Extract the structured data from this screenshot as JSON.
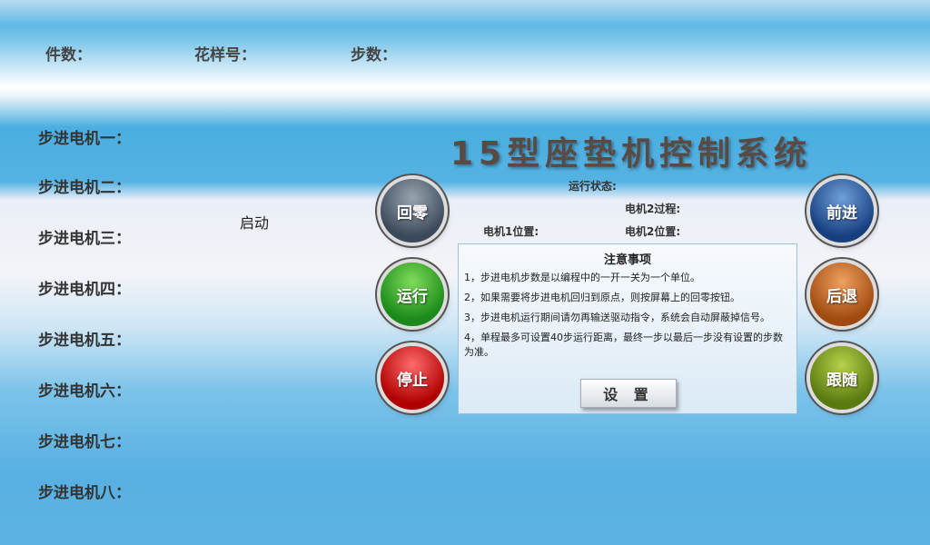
{
  "header": {
    "count_label": "件数：",
    "pattern_label": "花样号：",
    "steps_label": "步数："
  },
  "motors": [
    "步进电机一：",
    "步进电机二：",
    "步进电机三：",
    "步进电机四：",
    "步进电机五：",
    "步进电机六：",
    "步进电机七：",
    "步进电机八："
  ],
  "start_label": "启动",
  "title": "15型座垫机控制系统",
  "status": {
    "run_state": "运行状态:",
    "motor2_process": "电机2过程:",
    "motor1_position": "电机1位置:",
    "motor2_position": "电机2位置:"
  },
  "buttons": {
    "home": "回零",
    "run": "运行",
    "stop": "停止",
    "forward": "前进",
    "back": "后退",
    "follow": "跟随"
  },
  "notice": {
    "title": "注意事项",
    "items": [
      "1，步进电机步数是以编程中的一开一关为一个单位。",
      "2，如果需要将步进电机回归到原点，则按屏幕上的回零按钮。",
      "3，步进电机运行期间请勿再输送驱动指令，系统会自动屏蔽掉信号。",
      "4，单程最多可设置40步运行距离，最终一步以最后一步没有设置的步数为准。"
    ],
    "set_button": "设 置"
  },
  "colors": {
    "home": "#3b4a5a",
    "run": "#1a8a1a",
    "stop": "#b00000",
    "forward": "#173f80",
    "back": "#a04a10",
    "follow": "#5a7a10"
  }
}
